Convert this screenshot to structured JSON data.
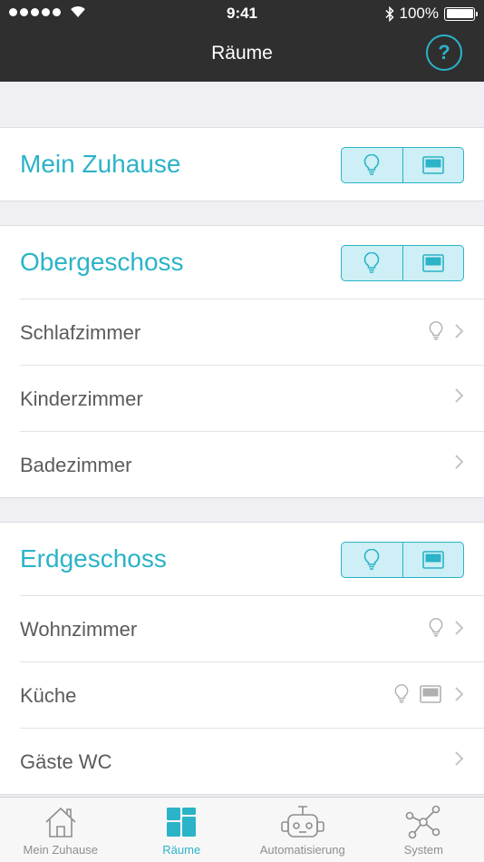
{
  "status_bar": {
    "time": "9:41",
    "battery": "100%"
  },
  "nav": {
    "title": "Räume",
    "help_label": "?"
  },
  "groups": [
    {
      "title": "Mein Zuhause",
      "rooms": []
    },
    {
      "title": "Obergeschoss",
      "rooms": [
        {
          "label": "Schlafzimmer",
          "icons": [
            "lightbulb-icon"
          ]
        },
        {
          "label": "Kinderzimmer",
          "icons": []
        },
        {
          "label": "Badezimmer",
          "icons": []
        }
      ]
    },
    {
      "title": "Erdgeschoss",
      "rooms": [
        {
          "label": "Wohnzimmer",
          "icons": [
            "lightbulb-icon"
          ]
        },
        {
          "label": "Küche",
          "icons": [
            "lightbulb-icon",
            "shutter-icon"
          ]
        },
        {
          "label": "Gäste WC",
          "icons": []
        }
      ]
    }
  ],
  "tabs": [
    {
      "label": "Mein Zuhause",
      "icon": "house-icon",
      "active": false
    },
    {
      "label": "Räume",
      "icon": "rooms-grid-icon",
      "active": true
    },
    {
      "label": "Automatisierung",
      "icon": "robot-icon",
      "active": false
    },
    {
      "label": "System",
      "icon": "network-icon",
      "active": false
    }
  ],
  "colors": {
    "accent": "#2bb3c8",
    "bar_dark": "#2f2f2f",
    "toggle_fill": "#cdeff5",
    "background": "#efeff4"
  }
}
